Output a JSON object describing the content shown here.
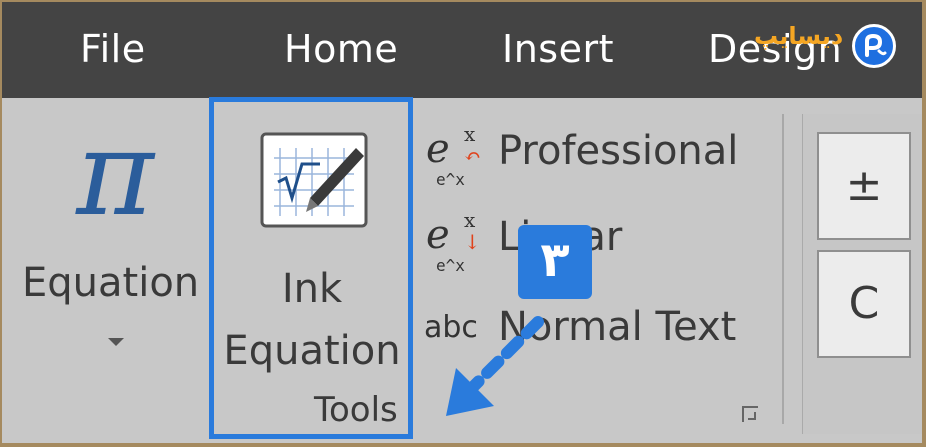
{
  "tabs": {
    "file": "File",
    "home": "Home",
    "insert": "Insert",
    "design": "Design"
  },
  "logo": {
    "text": "دیسایپ"
  },
  "equation": {
    "icon_glyph": "π",
    "label": "Equation"
  },
  "ink_equation": {
    "label_line1": "Ink",
    "label_line2": "Equation"
  },
  "tools_group": {
    "label": "Tools"
  },
  "conversions": {
    "professional": "Professional",
    "linear": "Linear",
    "normal_text": "Normal Text",
    "abc_icon": "abc"
  },
  "symbols": {
    "plus_minus": "±",
    "c_symbol": "C"
  },
  "annotation": {
    "step_number": "٣"
  },
  "colors": {
    "tab_bar": "#444444",
    "ribbon_bg": "#c8c8c8",
    "highlight": "#2a7bdc",
    "pi_blue": "#2b5d9b",
    "logo_orange": "#f5a623"
  }
}
